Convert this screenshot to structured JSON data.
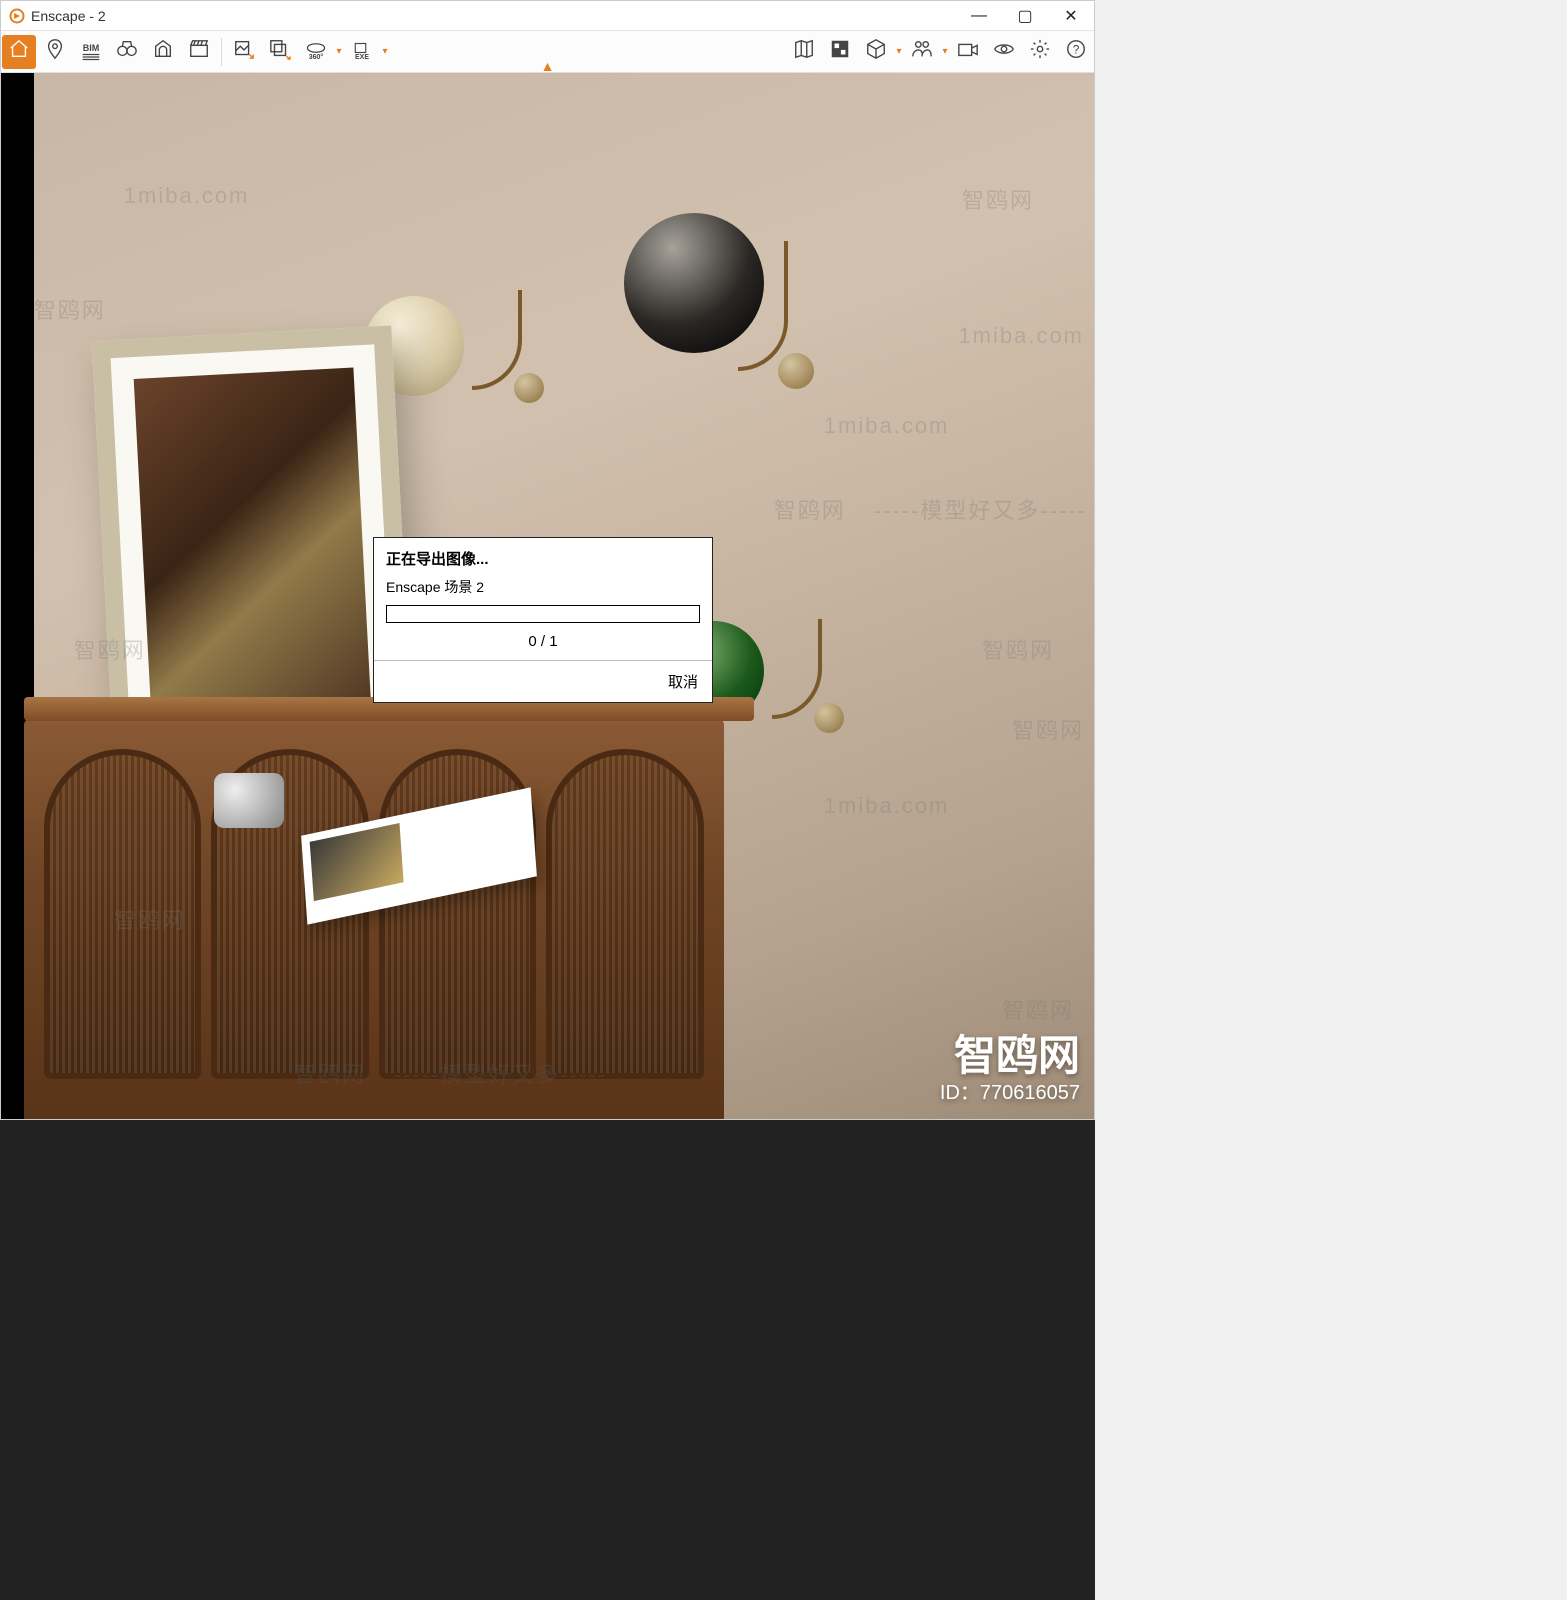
{
  "window": {
    "title": "Enscape - 2"
  },
  "titlebar": {
    "minimize": "—",
    "maximize": "▢",
    "close": "✕"
  },
  "toolbar": {
    "left": [
      {
        "name": "home-icon",
        "label": ""
      },
      {
        "name": "location-pin-icon",
        "label": ""
      },
      {
        "name": "bim-icon",
        "label": "BIM"
      },
      {
        "name": "binoculars-icon",
        "label": ""
      },
      {
        "name": "arch-icon",
        "label": ""
      },
      {
        "name": "clapperboard-icon",
        "label": ""
      },
      {
        "name": "export-image-icon",
        "label": ""
      },
      {
        "name": "export-batch-icon",
        "label": ""
      },
      {
        "name": "export-360-icon",
        "label": "360°"
      },
      {
        "name": "export-exe-icon",
        "label": "EXE"
      }
    ],
    "right": [
      {
        "name": "map-icon",
        "label": ""
      },
      {
        "name": "material-lib-icon",
        "label": ""
      },
      {
        "name": "cube-icon",
        "label": ""
      },
      {
        "name": "people-icon",
        "label": ""
      },
      {
        "name": "camera-icon",
        "label": ""
      },
      {
        "name": "visibility-icon",
        "label": ""
      },
      {
        "name": "settings-gear-icon",
        "label": ""
      },
      {
        "name": "help-icon",
        "label": "?"
      }
    ]
  },
  "dialog": {
    "title": "正在导出图像...",
    "scene": "Enscape 场景 2",
    "progress_text": "0 / 1",
    "cancel_label": "取消"
  },
  "watermarks": {
    "url": "1miba.com",
    "brand": "智鸥网",
    "tagline": "-----模型好又多-----",
    "id_label": "ID：",
    "id": "770616057"
  }
}
